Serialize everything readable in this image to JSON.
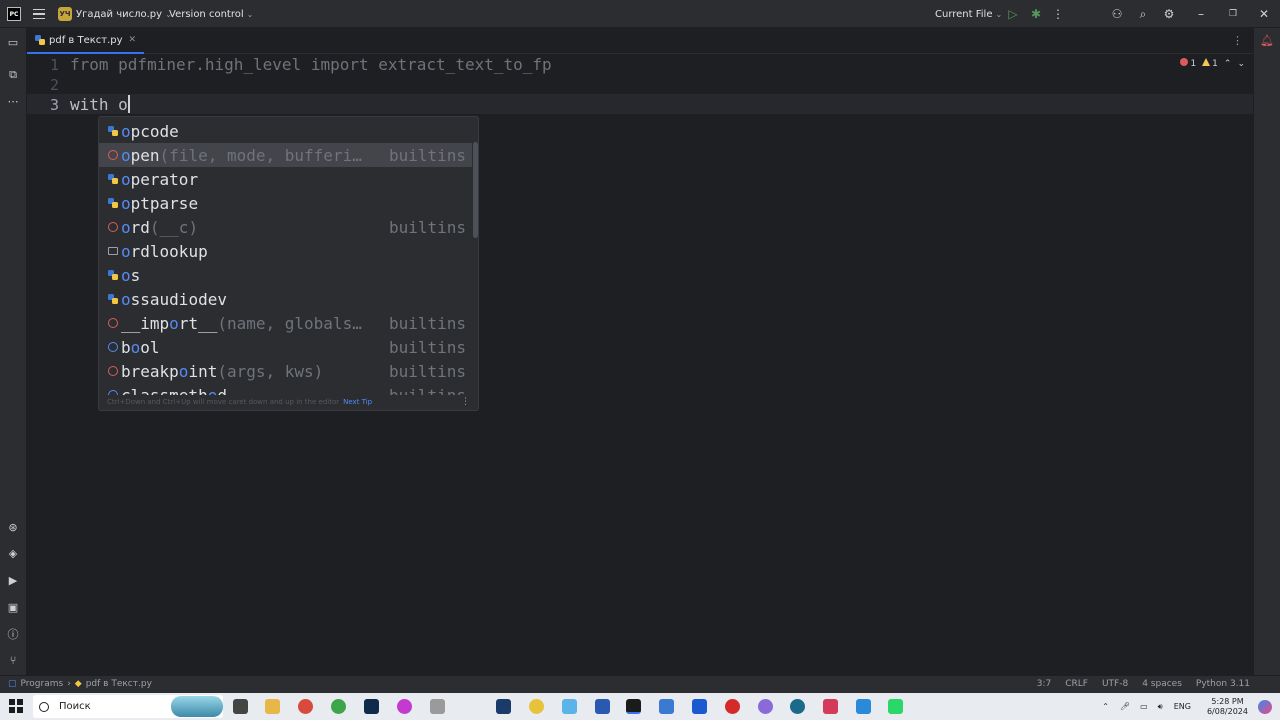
{
  "titlebar": {
    "project_badge": "УЧ",
    "project_name": "Угадай число.py",
    "vcs": "Version control",
    "run_config": "Current File"
  },
  "tabs": [
    {
      "label": "pdf в Текст.py"
    }
  ],
  "editor": {
    "lines": [
      {
        "number": "1",
        "text": "from pdfminer.high_level import extract_text_to_fp"
      },
      {
        "number": "2",
        "text": ""
      },
      {
        "number": "3",
        "text": "with o"
      }
    ],
    "inspections": {
      "errors": "1",
      "warnings": "1"
    }
  },
  "completion": {
    "items": [
      {
        "name_match": "o",
        "name_rest": "pcode",
        "params": "",
        "origin": "",
        "kind": "module"
      },
      {
        "name_match": "o",
        "name_rest": "pen",
        "params": "(file, mode, bufferi…",
        "origin": "builtins",
        "kind": "function",
        "selected": true
      },
      {
        "name_match": "o",
        "name_rest": "perator",
        "params": "",
        "origin": "",
        "kind": "module"
      },
      {
        "name_match": "o",
        "name_rest": "ptparse",
        "params": "",
        "origin": "",
        "kind": "module"
      },
      {
        "name_match": "o",
        "name_rest": "rd",
        "params": "(__c)",
        "origin": "builtins",
        "kind": "function"
      },
      {
        "name_match": "o",
        "name_rest": "rdlookup",
        "params": "",
        "origin": "",
        "kind": "directory"
      },
      {
        "name_match": "o",
        "name_rest": "s",
        "params": "",
        "origin": "",
        "kind": "module"
      },
      {
        "name_match": "o",
        "name_rest": "ssaudiodev",
        "params": "",
        "origin": "",
        "kind": "module"
      },
      {
        "name_match": "__imp",
        "name_rest": "o",
        "name_tail": "rt__",
        "params": "(name, globals…",
        "origin": "builtins",
        "kind": "function"
      },
      {
        "name_match": "b",
        "name_rest": "o",
        "name_tail": "ol",
        "params": "",
        "origin": "builtins",
        "kind": "class"
      },
      {
        "name_match": "breakp",
        "name_rest": "o",
        "name_tail": "int",
        "params": "(args, kws)",
        "origin": "builtins",
        "kind": "function"
      },
      {
        "name_match": "classmeth",
        "name_rest": "o",
        "name_tail": "d",
        "params": "",
        "origin": "builtins",
        "kind": "class"
      }
    ],
    "footer_text": "Ctrl+Down and Ctrl+Up will move caret down and up in the editor",
    "footer_link": "Next Tip"
  },
  "statusbar": {
    "breadcrumb_root": "Programs",
    "breadcrumb_file": "pdf в Текст.py",
    "position": "3:7",
    "line_ending": "CRLF",
    "encoding": "UTF-8",
    "indent": "4 spaces",
    "interpreter": "Python 3.11"
  },
  "taskbar": {
    "search_placeholder": "Поиск",
    "language": "ENG",
    "time": "5:28 PM",
    "date": "6/08/2024"
  }
}
